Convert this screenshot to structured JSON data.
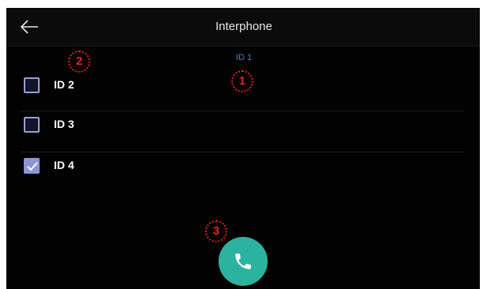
{
  "header": {
    "title": "Interphone",
    "back_icon": "arrow-left-icon"
  },
  "current_id": "ID 1",
  "contacts": [
    {
      "label": "ID 2",
      "checked": false
    },
    {
      "label": "ID 3",
      "checked": false
    },
    {
      "label": "ID 4",
      "checked": true
    }
  ],
  "call_button": {
    "icon": "phone-icon",
    "color": "#2bb3a0"
  },
  "callouts": [
    "1",
    "2",
    "3"
  ],
  "colors": {
    "background": "#020202",
    "accent_blue": "#3d7fd1",
    "checkbox": "#8c95d6",
    "callout_red": "#e0261d"
  }
}
